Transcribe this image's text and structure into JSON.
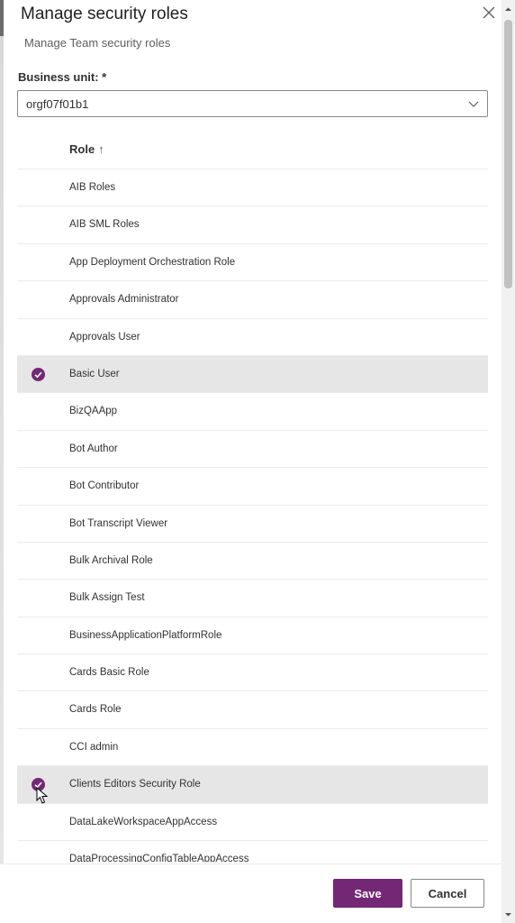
{
  "dialog": {
    "title": "Manage security roles",
    "subtitle": "Manage Team security roles",
    "close_icon": "close-icon"
  },
  "business_unit": {
    "label": "Business unit: *",
    "value": "orgf07f01b1"
  },
  "grid": {
    "column_header": "Role",
    "sort_indicator": "↑",
    "rows": [
      {
        "label": "AIB Roles",
        "selected": false
      },
      {
        "label": "AIB SML Roles",
        "selected": false
      },
      {
        "label": "App Deployment Orchestration Role",
        "selected": false
      },
      {
        "label": "Approvals Administrator",
        "selected": false
      },
      {
        "label": "Approvals User",
        "selected": false
      },
      {
        "label": "Basic User",
        "selected": true
      },
      {
        "label": "BizQAApp",
        "selected": false
      },
      {
        "label": "Bot Author",
        "selected": false
      },
      {
        "label": "Bot Contributor",
        "selected": false
      },
      {
        "label": "Bot Transcript Viewer",
        "selected": false
      },
      {
        "label": "Bulk Archival Role",
        "selected": false
      },
      {
        "label": "Bulk Assign Test",
        "selected": false
      },
      {
        "label": "BusinessApplicationPlatformRole",
        "selected": false
      },
      {
        "label": "Cards Basic Role",
        "selected": false
      },
      {
        "label": "Cards Role",
        "selected": false
      },
      {
        "label": "CCI admin",
        "selected": false
      },
      {
        "label": "Clients Editors Security Role",
        "selected": true
      },
      {
        "label": "DataLakeWorkspaceAppAccess",
        "selected": false
      },
      {
        "label": "DataProcessingConfigTableAppAccess",
        "selected": false
      }
    ]
  },
  "footer": {
    "save_label": "Save",
    "cancel_label": "Cancel"
  },
  "colors": {
    "accent": "#742774",
    "selected_row": "#e6e6e6"
  }
}
